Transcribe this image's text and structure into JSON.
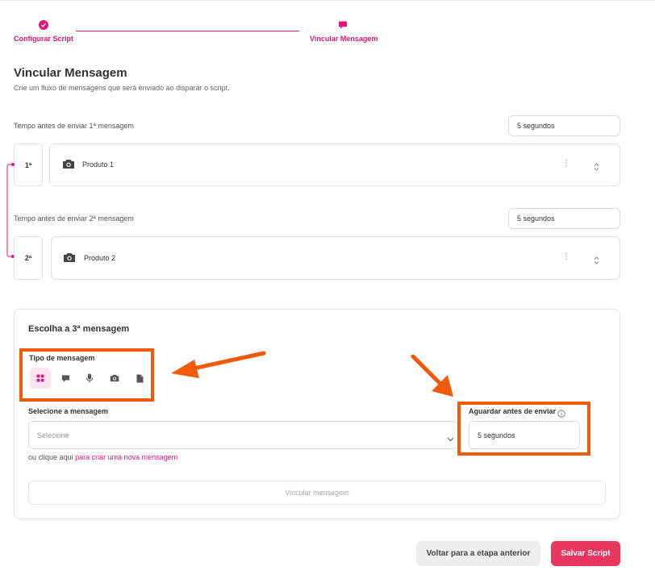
{
  "stepper": {
    "steps": [
      {
        "label": "Configurar Script",
        "icon": "check-icon"
      },
      {
        "label": "Vincular Mensagem",
        "icon": "chat-icon"
      }
    ]
  },
  "header": {
    "title": "Vincular Mensagem",
    "subtitle": "Crie um fluxo de mensagens que será enviado ao disparar o script."
  },
  "messages": [
    {
      "delay_label": "Tempo antes de enviar 1ª mensagem",
      "delay_value": "5 segundos",
      "index": "1ª",
      "name": "Produto 1",
      "icon": "camera-icon"
    },
    {
      "delay_label": "Tempo antes de enviar 2ª mensagem",
      "delay_value": "5 segundos",
      "index": "2ª",
      "name": "Produto 2",
      "icon": "camera-icon"
    }
  ],
  "new_message": {
    "title": "Escolha a 3ª mensagem",
    "type_label": "Tipo de mensagem",
    "types": [
      "grid-icon",
      "chat-icon",
      "microphone-icon",
      "camera-icon",
      "document-icon"
    ],
    "select_label": "Selecione a mensagem",
    "select_placeholder": "Selecione",
    "wait_label": "Aguardar antes de enviar",
    "wait_value": "5 segundos",
    "link_prefix": "ou clique aqui",
    "link_text": "para criar uma nova mensagem",
    "link_button": "Vincular mensagem"
  },
  "footer": {
    "back_label": "Voltar para a etapa anterior",
    "save_label": "Salvar Script"
  },
  "colors": {
    "accent": "#e6147a",
    "primary_button": "#e8365f",
    "annotation": "#f15a0a"
  }
}
